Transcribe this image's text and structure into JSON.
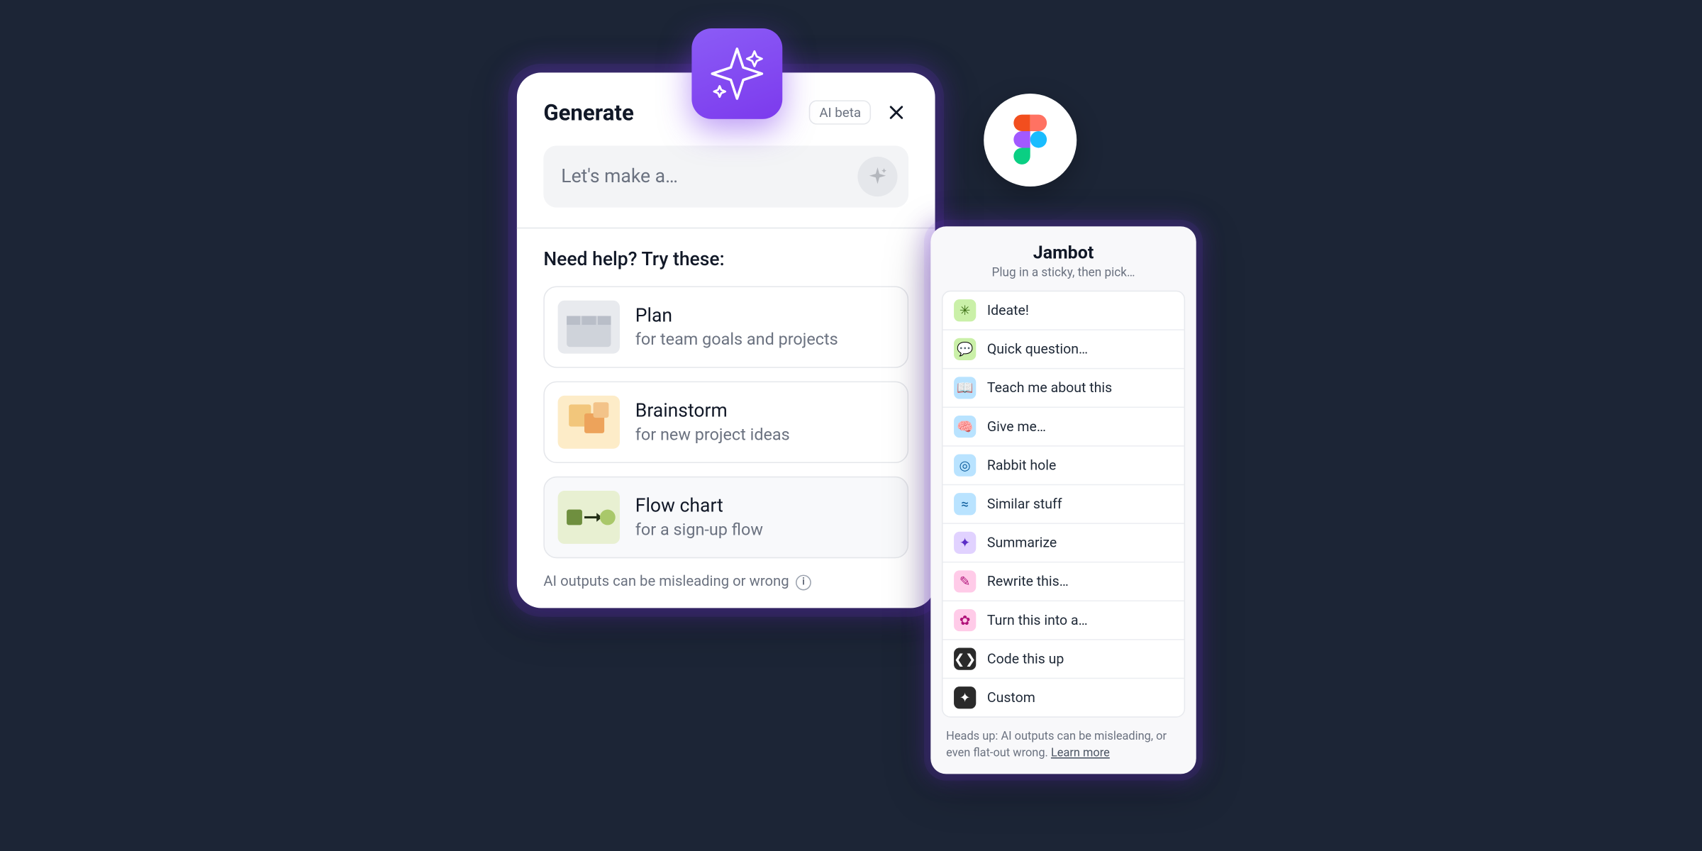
{
  "generate_panel": {
    "title": "Generate",
    "beta_badge": "AI beta",
    "prompt_placeholder": "Let's make a…",
    "try_heading": "Need help? Try these:",
    "suggestions": [
      {
        "title": "Plan",
        "subtitle": "for team goals and projects"
      },
      {
        "title": "Brainstorm",
        "subtitle": "for new project ideas"
      },
      {
        "title": "Flow chart",
        "subtitle": "for a sign-up flow"
      }
    ],
    "disclaimer": "AI outputs can be misleading or wrong"
  },
  "jambot": {
    "title": "Jambot",
    "subtitle": "Plug in a sticky, then pick…",
    "items": [
      {
        "label": "Ideate!",
        "icon": "✳",
        "bg": "#caf0a8",
        "fg": "#3a6d12"
      },
      {
        "label": "Quick question…",
        "icon": "💬",
        "bg": "#caf0a8",
        "fg": "#3a6d12"
      },
      {
        "label": "Teach me about this",
        "icon": "📖",
        "bg": "#b9e3ff",
        "fg": "#0b5c9c"
      },
      {
        "label": "Give me…",
        "icon": "🧠",
        "bg": "#b9e3ff",
        "fg": "#0b5c9c"
      },
      {
        "label": "Rabbit hole",
        "icon": "◎",
        "bg": "#b9e3ff",
        "fg": "#0b5c9c"
      },
      {
        "label": "Similar stuff",
        "icon": "≈",
        "bg": "#b9e3ff",
        "fg": "#0b5c9c"
      },
      {
        "label": "Summarize",
        "icon": "✦",
        "bg": "#e1d2ff",
        "fg": "#5b2ec6"
      },
      {
        "label": "Rewrite this…",
        "icon": "✎",
        "bg": "#ffcbe8",
        "fg": "#b1137a"
      },
      {
        "label": "Turn this into a…",
        "icon": "✿",
        "bg": "#ffcbe8",
        "fg": "#b1137a"
      },
      {
        "label": "Code this up",
        "icon": "❮❯",
        "bg": "#2a2a2a",
        "fg": "#ffffff"
      },
      {
        "label": "Custom",
        "icon": "✦",
        "bg": "#2a2a2a",
        "fg": "#ffffff"
      }
    ],
    "footer": {
      "text": "Heads up: AI outputs can be misleading, or even flat-out wrong. ",
      "learn_more": "Learn more"
    }
  }
}
